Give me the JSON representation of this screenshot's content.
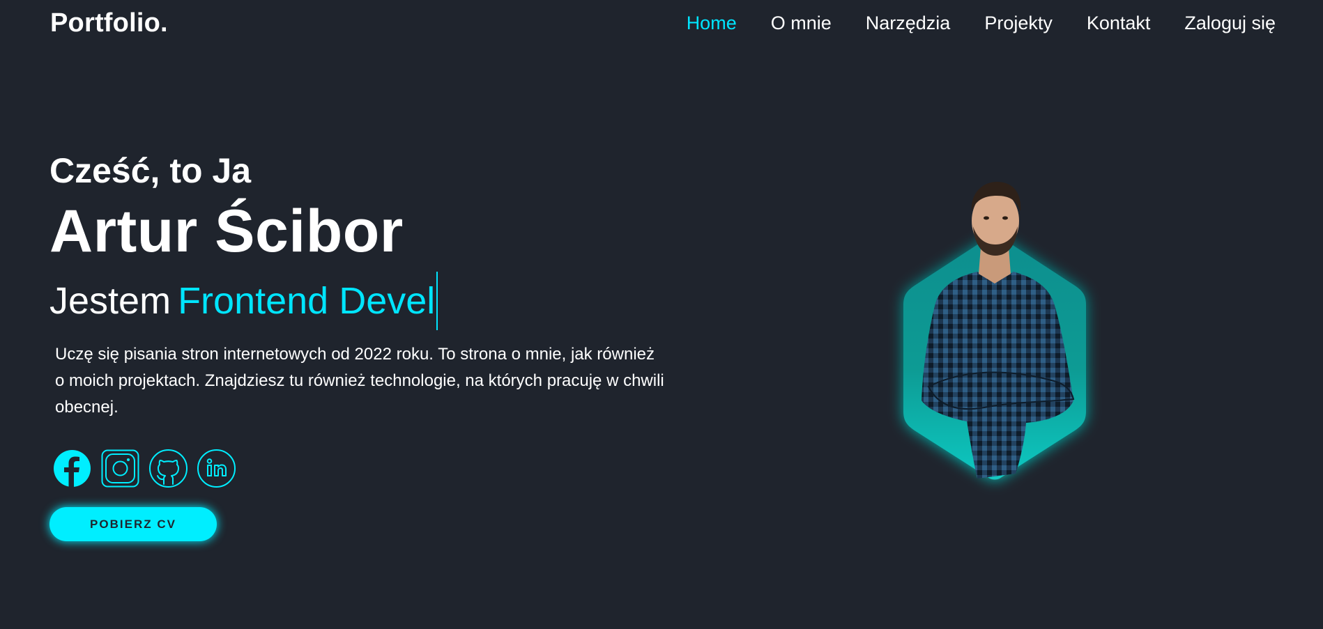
{
  "header": {
    "logo": "Portfolio.",
    "nav": [
      {
        "label": "Home",
        "active": true
      },
      {
        "label": "O mnie"
      },
      {
        "label": "Narzędzia"
      },
      {
        "label": "Projekty"
      },
      {
        "label": "Kontakt"
      },
      {
        "label": "Zaloguj się"
      }
    ]
  },
  "hero": {
    "greeting": "Cześć, to Ja",
    "name": "Artur Ścibor",
    "role_prefix": "Jestem",
    "role_typed": "Frontend Devel",
    "description": "Uczę się pisania stron internetowych od 2022 roku. To strona o mnie, jak również o moich projektach. Znajdziesz tu również technologie, na których pracuję w chwili obecnej.",
    "cv_button": "POBIERZ CV"
  },
  "socials": [
    {
      "icon": "facebook-icon"
    },
    {
      "icon": "instagram-icon"
    },
    {
      "icon": "github-icon"
    },
    {
      "icon": "linkedin-icon"
    }
  ],
  "colors": {
    "background": "#1f242d",
    "accent": "#00eeff",
    "text": "#ffffff"
  }
}
